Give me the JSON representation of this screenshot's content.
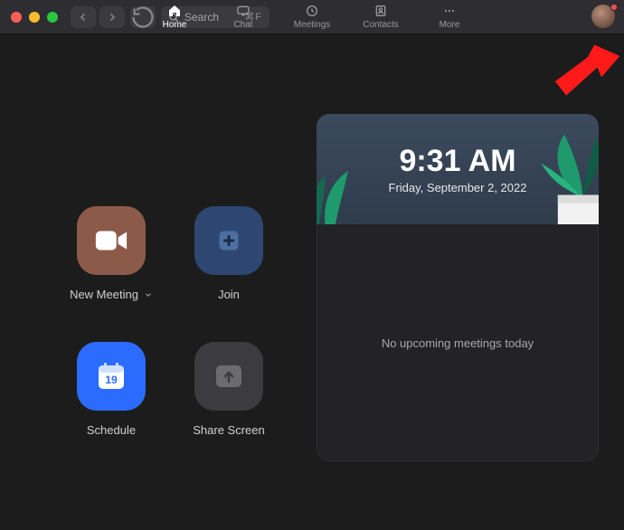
{
  "titlebar": {
    "search_placeholder": "Search",
    "search_shortcut": "⌘F",
    "tabs": [
      {
        "key": "home",
        "label": "Home",
        "active": true
      },
      {
        "key": "chat",
        "label": "Chat",
        "active": false
      },
      {
        "key": "meetings",
        "label": "Meetings",
        "active": false
      },
      {
        "key": "contacts",
        "label": "Contacts",
        "active": false
      },
      {
        "key": "more",
        "label": "More",
        "active": false
      }
    ]
  },
  "tiles": {
    "new_meeting": "New Meeting",
    "join": "Join",
    "schedule": "Schedule",
    "schedule_day": "19",
    "share_screen": "Share Screen"
  },
  "card": {
    "time": "9:31 AM",
    "date": "Friday, September 2, 2022",
    "empty_message": "No upcoming meetings today"
  },
  "annotation": {
    "type": "red-arrow",
    "target": "settings-gear-icon"
  }
}
